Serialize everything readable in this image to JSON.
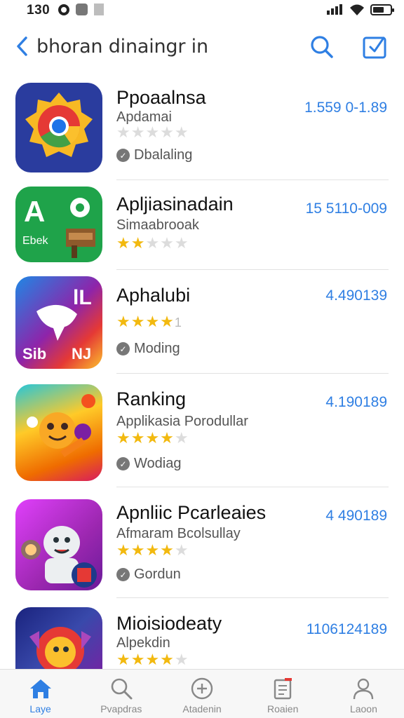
{
  "status_bar": {
    "time": "130"
  },
  "nav": {
    "title": "bhoran dinaingr in"
  },
  "apps": [
    {
      "name": "Ppoaalnsa",
      "subtitle": "Apdamai",
      "stars": 0,
      "star_count": "",
      "status": "Dbalaling",
      "price": "1.559 0-1.89"
    },
    {
      "name": "Apljiasinadain",
      "subtitle": "Simaabrooak",
      "stars": 2,
      "star_count": "",
      "status": "",
      "price": "15 5110-009"
    },
    {
      "name": "Aphalubi",
      "subtitle": "",
      "stars": 4,
      "star_count": "1",
      "status": "Moding",
      "price": "4.490139"
    },
    {
      "name": "Ranking",
      "subtitle": "Applikasia Porodullar",
      "stars": 4,
      "star_count": "",
      "status": "Wodiag",
      "price": "4.190189"
    },
    {
      "name": "Apnliic Pcarleaies",
      "subtitle": "Afmaram Bcolsullay",
      "stars": 4,
      "star_count": "",
      "status": "Gordun",
      "price": "4 490189"
    },
    {
      "name": "Mioisiodeaty",
      "subtitle": "Alpekdin",
      "stars": 4,
      "star_count": "",
      "status": "",
      "price": "1106124189"
    }
  ],
  "tabs": [
    {
      "label": "Laye",
      "icon": "home-icon",
      "active": true
    },
    {
      "label": "Pvapdras",
      "icon": "search-icon",
      "active": false
    },
    {
      "label": "Atadenin",
      "icon": "plus-circle-icon",
      "active": false
    },
    {
      "label": "Roaien",
      "icon": "clipboard-icon",
      "active": false
    },
    {
      "label": "Laoon",
      "icon": "person-icon",
      "active": false
    }
  ],
  "colors": {
    "accent": "#2f7fe3",
    "star": "#f2b90f"
  }
}
